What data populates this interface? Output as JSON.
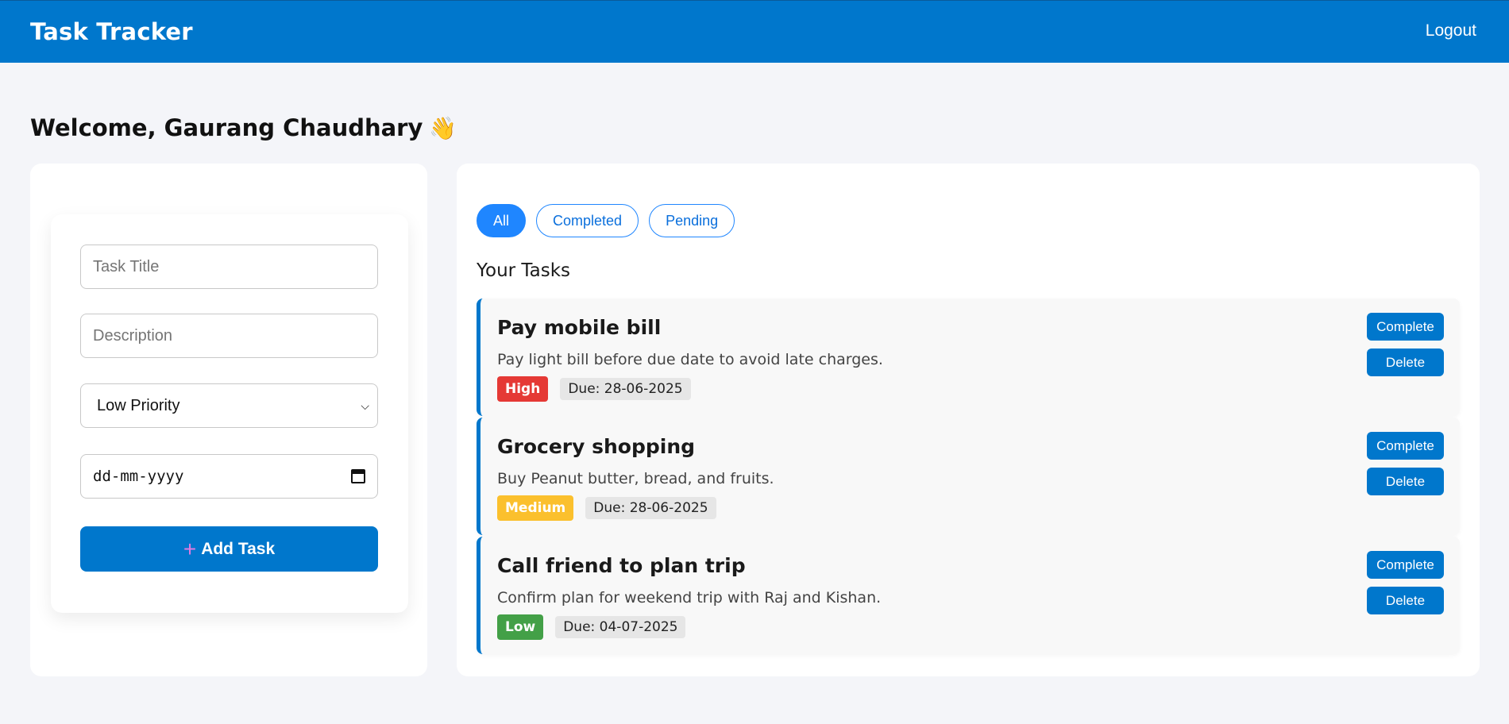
{
  "header": {
    "title": "Task Tracker",
    "logout_label": "Logout"
  },
  "welcome": {
    "text": "Welcome, Gaurang Chaudhary",
    "emoji": "👋"
  },
  "form": {
    "title_placeholder": "Task Title",
    "description_placeholder": "Description",
    "priority_selected": "Low Priority",
    "date_placeholder": "dd-mm-yyyy",
    "add_label": "Add Task",
    "add_icon": "+"
  },
  "filters": {
    "all": "All",
    "completed": "Completed",
    "pending": "Pending",
    "active": "All"
  },
  "tasks_heading": "Your Tasks",
  "colors": {
    "accent": "#0077cc",
    "high": "#e53935",
    "medium": "#fbc02d",
    "low": "#43a047"
  },
  "tasks": [
    {
      "title": "Pay mobile bill",
      "description": "Pay light bill before due date to avoid late charges.",
      "priority": "High",
      "due": "Due: 28-06-2025",
      "complete_label": "Complete",
      "delete_label": "Delete"
    },
    {
      "title": "Grocery shopping",
      "description": "Buy Peanut butter, bread, and fruits.",
      "priority": "Medium",
      "due": "Due: 28-06-2025",
      "complete_label": "Complete",
      "delete_label": "Delete"
    },
    {
      "title": "Call friend to plan trip",
      "description": "Confirm plan for weekend trip with Raj and Kishan.",
      "priority": "Low",
      "due": "Due: 04-07-2025",
      "complete_label": "Complete",
      "delete_label": "Delete"
    }
  ]
}
